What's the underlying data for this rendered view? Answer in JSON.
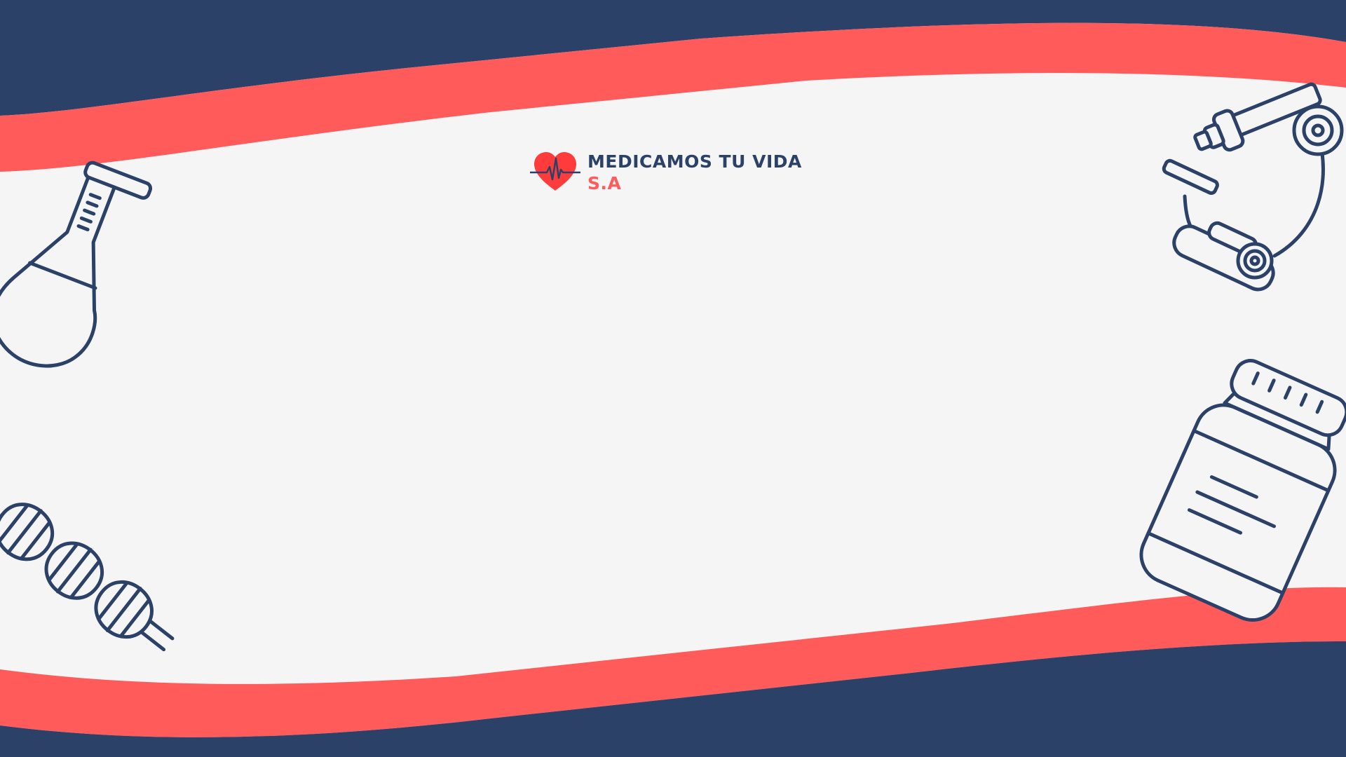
{
  "brand": {
    "name_line1": "MEDICAMOS TU VIDA",
    "name_line2": "S.A"
  },
  "colors": {
    "navy": "#2b4168",
    "coral": "#ff5b5b",
    "background": "#f5f5f6",
    "heart": "#ff3b3b"
  },
  "icons": [
    "heart-pulse-icon",
    "test-tube-icon",
    "microscope-icon",
    "pill-bottle-icon",
    "dna-icon"
  ]
}
